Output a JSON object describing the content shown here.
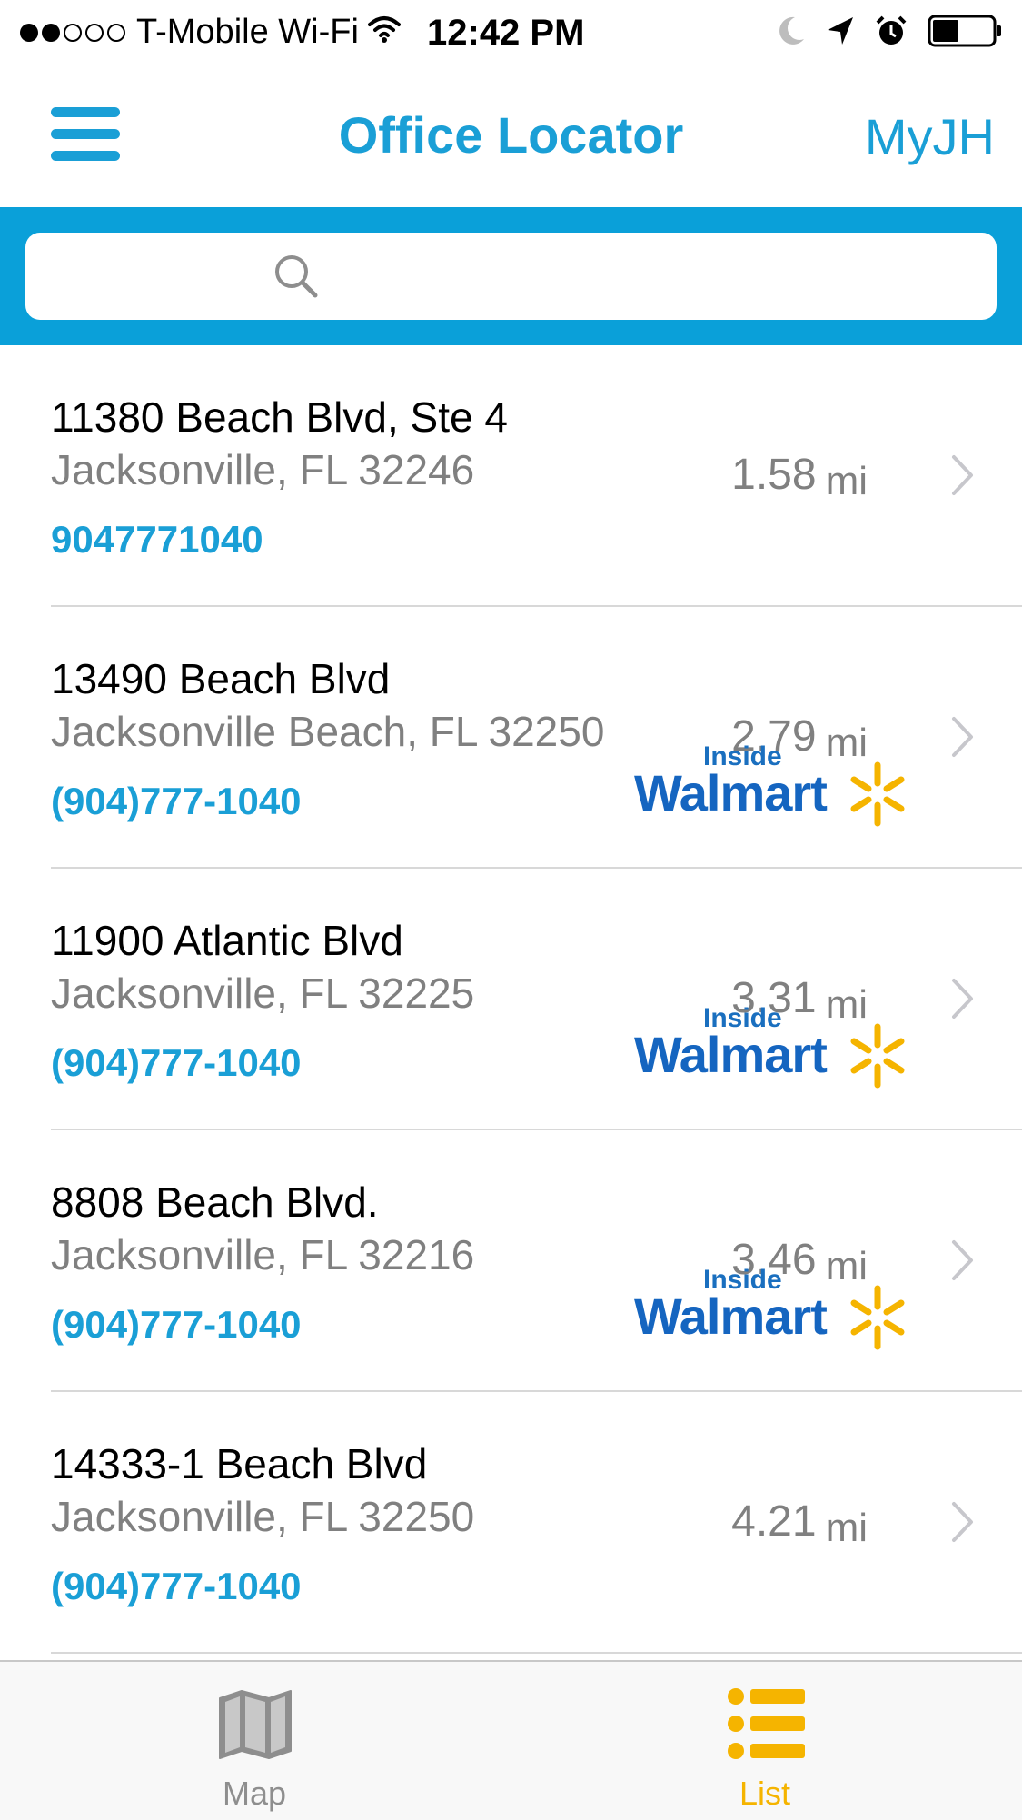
{
  "status_bar": {
    "signal_filled": 2,
    "signal_total": 5,
    "carrier": "T-Mobile Wi-Fi",
    "time": "12:42 PM"
  },
  "nav": {
    "title": "Office Locator",
    "right_label": "MyJH"
  },
  "search": {
    "placeholder": "",
    "value": ""
  },
  "offices": [
    {
      "address": "11380 Beach Blvd, Ste 4",
      "city": "Jacksonville, FL 32246",
      "phone": "9047771040",
      "distance": "1.58",
      "unit": "mi",
      "inside_walmart": false
    },
    {
      "address": "13490 Beach Blvd",
      "city": "Jacksonville Beach, FL 32250",
      "phone": "(904)777-1040",
      "distance": "2.79",
      "unit": "mi",
      "inside_walmart": true,
      "badge_top": "Inside",
      "badge_name": "Walmart"
    },
    {
      "address": "11900 Atlantic Blvd",
      "city": "Jacksonville, FL 32225",
      "phone": "(904)777-1040",
      "distance": "3.31",
      "unit": "mi",
      "inside_walmart": true,
      "badge_top": "Inside",
      "badge_name": "Walmart"
    },
    {
      "address": "8808 Beach Blvd.",
      "city": "Jacksonville, FL 32216",
      "phone": "(904)777-1040",
      "distance": "3.46",
      "unit": "mi",
      "inside_walmart": true,
      "badge_top": "Inside",
      "badge_name": "Walmart"
    },
    {
      "address": "14333-1 Beach Blvd",
      "city": "Jacksonville, FL 32250",
      "phone": "(904)777-1040",
      "distance": "4.21",
      "unit": "mi",
      "inside_walmart": false
    }
  ],
  "tabs": {
    "map": {
      "label": "Map",
      "icon": "map-icon",
      "active": false
    },
    "list": {
      "label": "List",
      "icon": "list-icon",
      "active": true
    }
  },
  "colors": {
    "accent": "#1a9fd6",
    "search_bg": "#0aa0d9",
    "active_tab": "#f5b400",
    "walmart_blue": "#1565c0",
    "walmart_yellow": "#f5b400"
  }
}
